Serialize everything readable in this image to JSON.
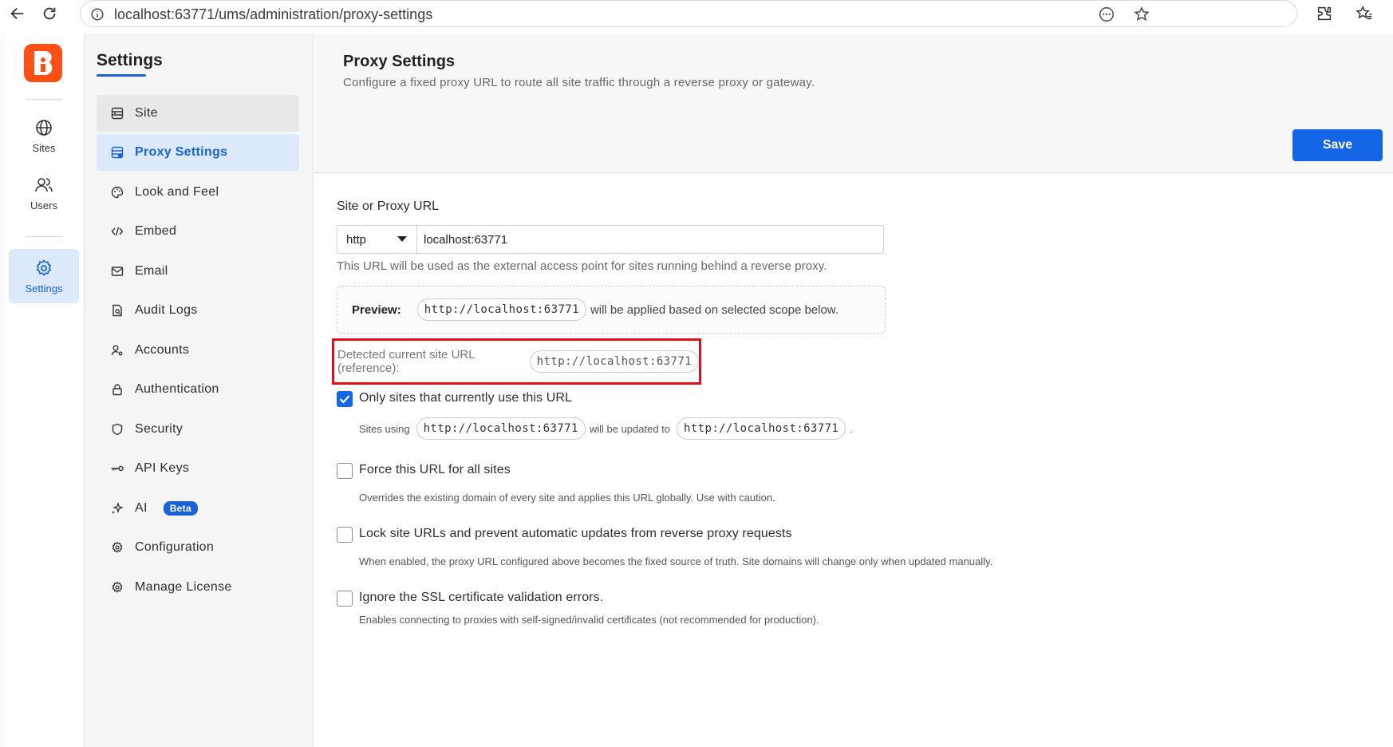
{
  "browser": {
    "url": "localhost:63771/ums/administration/proxy-settings"
  },
  "rail": {
    "items": [
      {
        "label": "Sites",
        "icon": "globe-icon"
      },
      {
        "label": "Users",
        "icon": "users-icon"
      },
      {
        "label": "Settings",
        "icon": "gear-icon"
      }
    ],
    "active": "Settings"
  },
  "settings": {
    "title": "Settings",
    "menu": [
      {
        "label": "Site",
        "icon": "server-icon"
      },
      {
        "label": "Proxy Settings",
        "icon": "proxy-icon"
      },
      {
        "label": "Look and Feel",
        "icon": "palette-icon"
      },
      {
        "label": "Embed",
        "icon": "code-icon"
      },
      {
        "label": "Email",
        "icon": "mail-icon"
      },
      {
        "label": "Audit Logs",
        "icon": "audit-icon"
      },
      {
        "label": "Accounts",
        "icon": "accounts-icon"
      },
      {
        "label": "Authentication",
        "icon": "lock-icon"
      },
      {
        "label": "Security",
        "icon": "shield-icon"
      },
      {
        "label": "API Keys",
        "icon": "key-icon"
      },
      {
        "label": "AI",
        "icon": "sparkle-icon",
        "badge": "Beta"
      },
      {
        "label": "Configuration",
        "icon": "gear-icon"
      },
      {
        "label": "Manage License",
        "icon": "license-icon"
      }
    ]
  },
  "page": {
    "title": "Proxy Settings",
    "subtitle": "Configure a fixed proxy URL to route all site traffic through a reverse proxy or gateway.",
    "save_label": "Save"
  },
  "form": {
    "label": "Site or Proxy URL",
    "protocol": "http",
    "url_value": "localhost:63771",
    "help": "This URL will be used as the external access point for sites running behind a reverse proxy.",
    "preview_label": "Preview:",
    "preview_url": "http://localhost:63771",
    "preview_suffix": "will be applied based on selected scope below.",
    "detected_label": "Detected current site URL (reference):",
    "detected_url": "http://localhost:63771"
  },
  "options": {
    "only_sites": {
      "label": "Only sites that currently use this URL",
      "checked": true,
      "sites_using": "Sites using",
      "from_url": "http://localhost:63771",
      "updated_to": "will be updated to",
      "to_url": "http://localhost:63771",
      "period": "."
    },
    "force": {
      "label": "Force this URL for all sites",
      "desc": "Overrides the existing domain of every site and applies this URL globally. Use with caution.",
      "checked": false
    },
    "lock": {
      "label": "Lock site URLs and prevent automatic updates from reverse proxy requests",
      "desc": "When enabled, the proxy URL configured above becomes the fixed source of truth. Site domains will change only when updated manually.",
      "checked": false
    },
    "ssl": {
      "label": "Ignore the SSL certificate validation errors.",
      "desc": "Enables connecting to proxies with self-signed/invalid certificates (not recommended for production).",
      "checked": false
    }
  },
  "colors": {
    "accent": "#1466e6",
    "brand": "#ff4f16",
    "highlight": "#e0101b"
  }
}
